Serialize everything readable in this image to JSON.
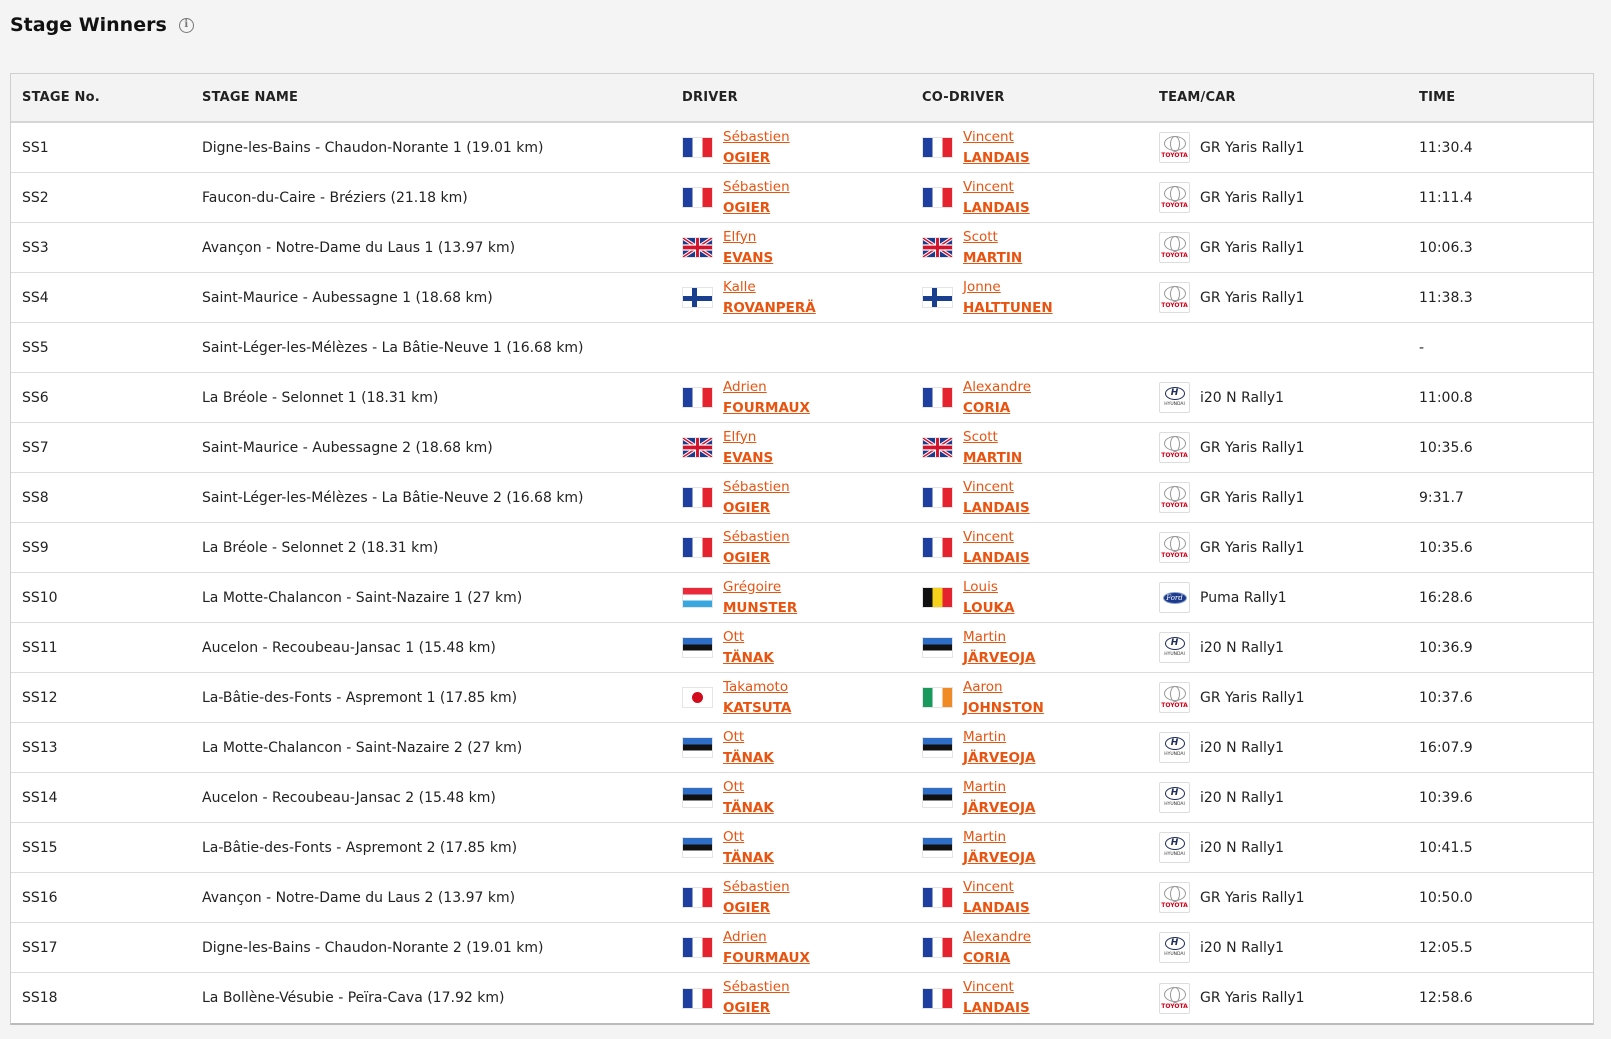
{
  "page": {
    "title": "Stage Winners",
    "info_icon": "info-icon"
  },
  "columns": [
    "STAGE No.",
    "STAGE NAME",
    "DRIVER",
    "CO-DRIVER",
    "TEAM/CAR",
    "TIME"
  ],
  "rows": [
    {
      "stage": "SS1",
      "name": "Digne-les-Bains - Chaudon-Norante 1 (19.01 km)",
      "driver_flag": "fr",
      "driver_first": "Sébastien",
      "driver_last": "OGIER",
      "codriver_flag": "fr",
      "codriver_first": "Vincent",
      "codriver_last": "LANDAIS",
      "logo": "toyota",
      "car": "GR Yaris Rally1",
      "time": "11:30.4"
    },
    {
      "stage": "SS2",
      "name": "Faucon-du-Caire - Bréziers (21.18 km)",
      "driver_flag": "fr",
      "driver_first": "Sébastien",
      "driver_last": "OGIER",
      "codriver_flag": "fr",
      "codriver_first": "Vincent",
      "codriver_last": "LANDAIS",
      "logo": "toyota",
      "car": "GR Yaris Rally1",
      "time": "11:11.4"
    },
    {
      "stage": "SS3",
      "name": "Avançon - Notre-Dame du Laus 1 (13.97 km)",
      "driver_flag": "gb",
      "driver_first": "Elfyn",
      "driver_last": "EVANS",
      "codriver_flag": "gb",
      "codriver_first": "Scott",
      "codriver_last": "MARTIN",
      "logo": "toyota",
      "car": "GR Yaris Rally1",
      "time": "10:06.3"
    },
    {
      "stage": "SS4",
      "name": "Saint-Maurice - Aubessagne 1 (18.68 km)",
      "driver_flag": "fi",
      "driver_first": "Kalle",
      "driver_last": "ROVANPERÄ",
      "codriver_flag": "fi",
      "codriver_first": "Jonne",
      "codriver_last": "HALTTUNEN",
      "logo": "toyota",
      "car": "GR Yaris Rally1",
      "time": "11:38.3"
    },
    {
      "stage": "SS5",
      "name": "Saint-Léger-les-Mélèzes - La Bâtie-Neuve 1 (16.68 km)",
      "driver_flag": "",
      "driver_first": "",
      "driver_last": "",
      "codriver_flag": "",
      "codriver_first": "",
      "codriver_last": "",
      "logo": "",
      "car": "",
      "time": "-"
    },
    {
      "stage": "SS6",
      "name": "La Bréole - Selonnet 1 (18.31 km)",
      "driver_flag": "fr",
      "driver_first": "Adrien",
      "driver_last": "FOURMAUX",
      "codriver_flag": "fr",
      "codriver_first": "Alexandre",
      "codriver_last": "CORIA",
      "logo": "hyundai",
      "car": "i20 N Rally1",
      "time": "11:00.8"
    },
    {
      "stage": "SS7",
      "name": "Saint-Maurice - Aubessagne 2 (18.68 km)",
      "driver_flag": "gb",
      "driver_first": "Elfyn",
      "driver_last": "EVANS",
      "codriver_flag": "gb",
      "codriver_first": "Scott",
      "codriver_last": "MARTIN",
      "logo": "toyota",
      "car": "GR Yaris Rally1",
      "time": "10:35.6"
    },
    {
      "stage": "SS8",
      "name": "Saint-Léger-les-Mélèzes - La Bâtie-Neuve 2 (16.68 km)",
      "driver_flag": "fr",
      "driver_first": "Sébastien",
      "driver_last": "OGIER",
      "codriver_flag": "fr",
      "codriver_first": "Vincent",
      "codriver_last": "LANDAIS",
      "logo": "toyota",
      "car": "GR Yaris Rally1",
      "time": "9:31.7"
    },
    {
      "stage": "SS9",
      "name": "La Bréole - Selonnet 2 (18.31 km)",
      "driver_flag": "fr",
      "driver_first": "Sébastien",
      "driver_last": "OGIER",
      "codriver_flag": "fr",
      "codriver_first": "Vincent",
      "codriver_last": "LANDAIS",
      "logo": "toyota",
      "car": "GR Yaris Rally1",
      "time": "10:35.6"
    },
    {
      "stage": "SS10",
      "name": "La Motte-Chalancon - Saint-Nazaire 1 (27 km)",
      "driver_flag": "lu",
      "driver_first": "Grégoire",
      "driver_last": "MUNSTER",
      "codriver_flag": "be",
      "codriver_first": "Louis",
      "codriver_last": "LOUKA",
      "logo": "ford",
      "car": "Puma Rally1",
      "time": "16:28.6"
    },
    {
      "stage": "SS11",
      "name": "Aucelon - Recoubeau-Jansac 1 (15.48 km)",
      "driver_flag": "ee",
      "driver_first": "Ott",
      "driver_last": "TÄNAK",
      "codriver_flag": "ee",
      "codriver_first": "Martin",
      "codriver_last": "JÄRVEOJA",
      "logo": "hyundai",
      "car": "i20 N Rally1",
      "time": "10:36.9"
    },
    {
      "stage": "SS12",
      "name": "La-Bâtie-des-Fonts - Aspremont 1 (17.85 km)",
      "driver_flag": "jp",
      "driver_first": "Takamoto",
      "driver_last": "KATSUTA",
      "codriver_flag": "ie",
      "codriver_first": "Aaron",
      "codriver_last": "JOHNSTON",
      "logo": "toyota",
      "car": "GR Yaris Rally1",
      "time": "10:37.6"
    },
    {
      "stage": "SS13",
      "name": "La Motte-Chalancon - Saint-Nazaire 2 (27 km)",
      "driver_flag": "ee",
      "driver_first": "Ott",
      "driver_last": "TÄNAK",
      "codriver_flag": "ee",
      "codriver_first": "Martin",
      "codriver_last": "JÄRVEOJA",
      "logo": "hyundai",
      "car": "i20 N Rally1",
      "time": "16:07.9"
    },
    {
      "stage": "SS14",
      "name": "Aucelon - Recoubeau-Jansac 2 (15.48 km)",
      "driver_flag": "ee",
      "driver_first": "Ott",
      "driver_last": "TÄNAK",
      "codriver_flag": "ee",
      "codriver_first": "Martin",
      "codriver_last": "JÄRVEOJA",
      "logo": "hyundai",
      "car": "i20 N Rally1",
      "time": "10:39.6"
    },
    {
      "stage": "SS15",
      "name": "La-Bâtie-des-Fonts - Aspremont 2 (17.85 km)",
      "driver_flag": "ee",
      "driver_first": "Ott",
      "driver_last": "TÄNAK",
      "codriver_flag": "ee",
      "codriver_first": "Martin",
      "codriver_last": "JÄRVEOJA",
      "logo": "hyundai",
      "car": "i20 N Rally1",
      "time": "10:41.5"
    },
    {
      "stage": "SS16",
      "name": "Avançon - Notre-Dame du Laus 2 (13.97 km)",
      "driver_flag": "fr",
      "driver_first": "Sébastien",
      "driver_last": "OGIER",
      "codriver_flag": "fr",
      "codriver_first": "Vincent",
      "codriver_last": "LANDAIS",
      "logo": "toyota",
      "car": "GR Yaris Rally1",
      "time": "10:50.0"
    },
    {
      "stage": "SS17",
      "name": "Digne-les-Bains - Chaudon-Norante 2 (19.01 km)",
      "driver_flag": "fr",
      "driver_first": "Adrien",
      "driver_last": "FOURMAUX",
      "codriver_flag": "fr",
      "codriver_first": "Alexandre",
      "codriver_last": "CORIA",
      "logo": "hyundai",
      "car": "i20 N Rally1",
      "time": "12:05.5"
    },
    {
      "stage": "SS18",
      "name": "La Bollène-Vésubie - Peïra-Cava (17.92 km)",
      "driver_flag": "fr",
      "driver_first": "Sébastien",
      "driver_last": "OGIER",
      "codriver_flag": "fr",
      "codriver_first": "Vincent",
      "codriver_last": "LANDAIS",
      "logo": "toyota",
      "car": "GR Yaris Rally1",
      "time": "12:58.6"
    }
  ],
  "colors": {
    "link": "#e8530f",
    "header_bg": "#f3f3f3",
    "page_bg": "#f4f4f4"
  }
}
